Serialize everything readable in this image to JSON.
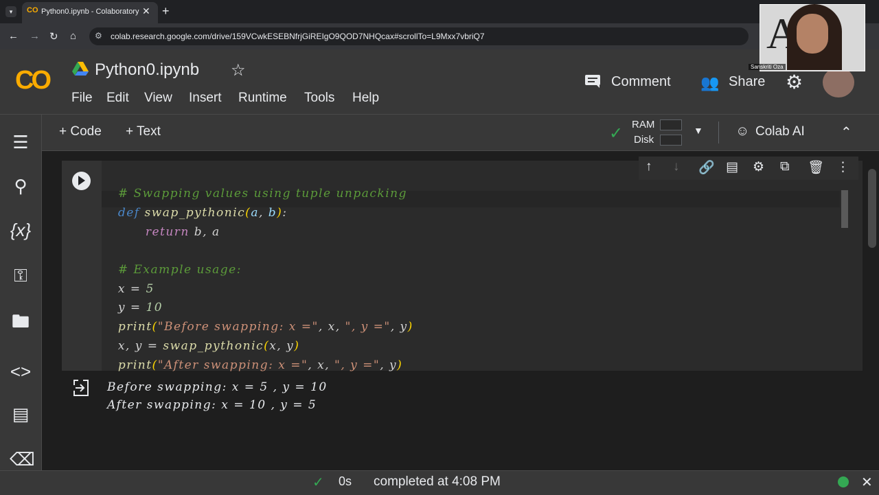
{
  "browser": {
    "tab_title": "Python0.ipynb - Colaboratory",
    "tab_favicon": "CO",
    "url": "colab.research.google.com/drive/159VCwkESEBNfrjGiREIgO9QOD7NHQcax#scrollTo=L9Mxx7vbriQ7",
    "icons": [
      "tab-menu-icon",
      "close-icon",
      "new-tab-icon",
      "back-icon",
      "forward-icon",
      "reload-icon",
      "home-icon",
      "site-info-icon"
    ]
  },
  "webcam": {
    "name": "Sanskriti Oza",
    "background_text": "AI0"
  },
  "header": {
    "logo": "CO",
    "notebook_title": "Python0.ipynb",
    "menus": [
      "File",
      "Edit",
      "View",
      "Insert",
      "Runtime",
      "Tools",
      "Help"
    ],
    "comment_label": "Comment",
    "share_label": "Share"
  },
  "toolbar": {
    "add_code": "+ Code",
    "add_text": "+ Text",
    "ram_label": "RAM",
    "disk_label": "Disk",
    "colab_ai": "Colab AI"
  },
  "cell": {
    "code": {
      "l1_comment": "# Swapping values using tuple unpacking",
      "l2_def": "def",
      "l2_name": "swap_pythonic",
      "l2_open": "(",
      "l2_a": "a",
      "l2_comma": ", ",
      "l2_b": "b",
      "l2_close": ")",
      "l2_colon": ":",
      "l3_return": "return",
      "l3_rest": "b, a",
      "l4_comment": "# Example usage:",
      "l5_x": "x",
      "l5_eq": " = ",
      "l5_val": "5",
      "l6_y": "y",
      "l6_eq": " = ",
      "l6_val": "10",
      "l7_print": "print",
      "l7_open": "(",
      "l7_str1": "\"Before swapping: x =\"",
      "l7_mid": ", x, ",
      "l7_str2": "\", y =\"",
      "l7_end": ", y",
      "l7_close": ")",
      "l8_lhs": "x, y = ",
      "l8_fn": "swap_pythonic",
      "l8_open": "(",
      "l8_args": "x, y",
      "l8_close": ")",
      "l9_print": "print",
      "l9_open": "(",
      "l9_str1": "\"After swapping: x =\"",
      "l9_mid": ", x, ",
      "l9_str2": "\", y =\"",
      "l9_end": ", y",
      "l9_close": ")"
    },
    "output": [
      "Before swapping: x = 5 , y = 10",
      "After swapping: x = 10 , y = 5"
    ]
  },
  "status": {
    "duration": "0s",
    "message": "completed at 4:08 PM"
  },
  "colors": {
    "accent": "#f9ab00",
    "success": "#34a853",
    "comment": "#5c9b3a",
    "keyword": "#4a86c7",
    "string": "#ce9178"
  }
}
